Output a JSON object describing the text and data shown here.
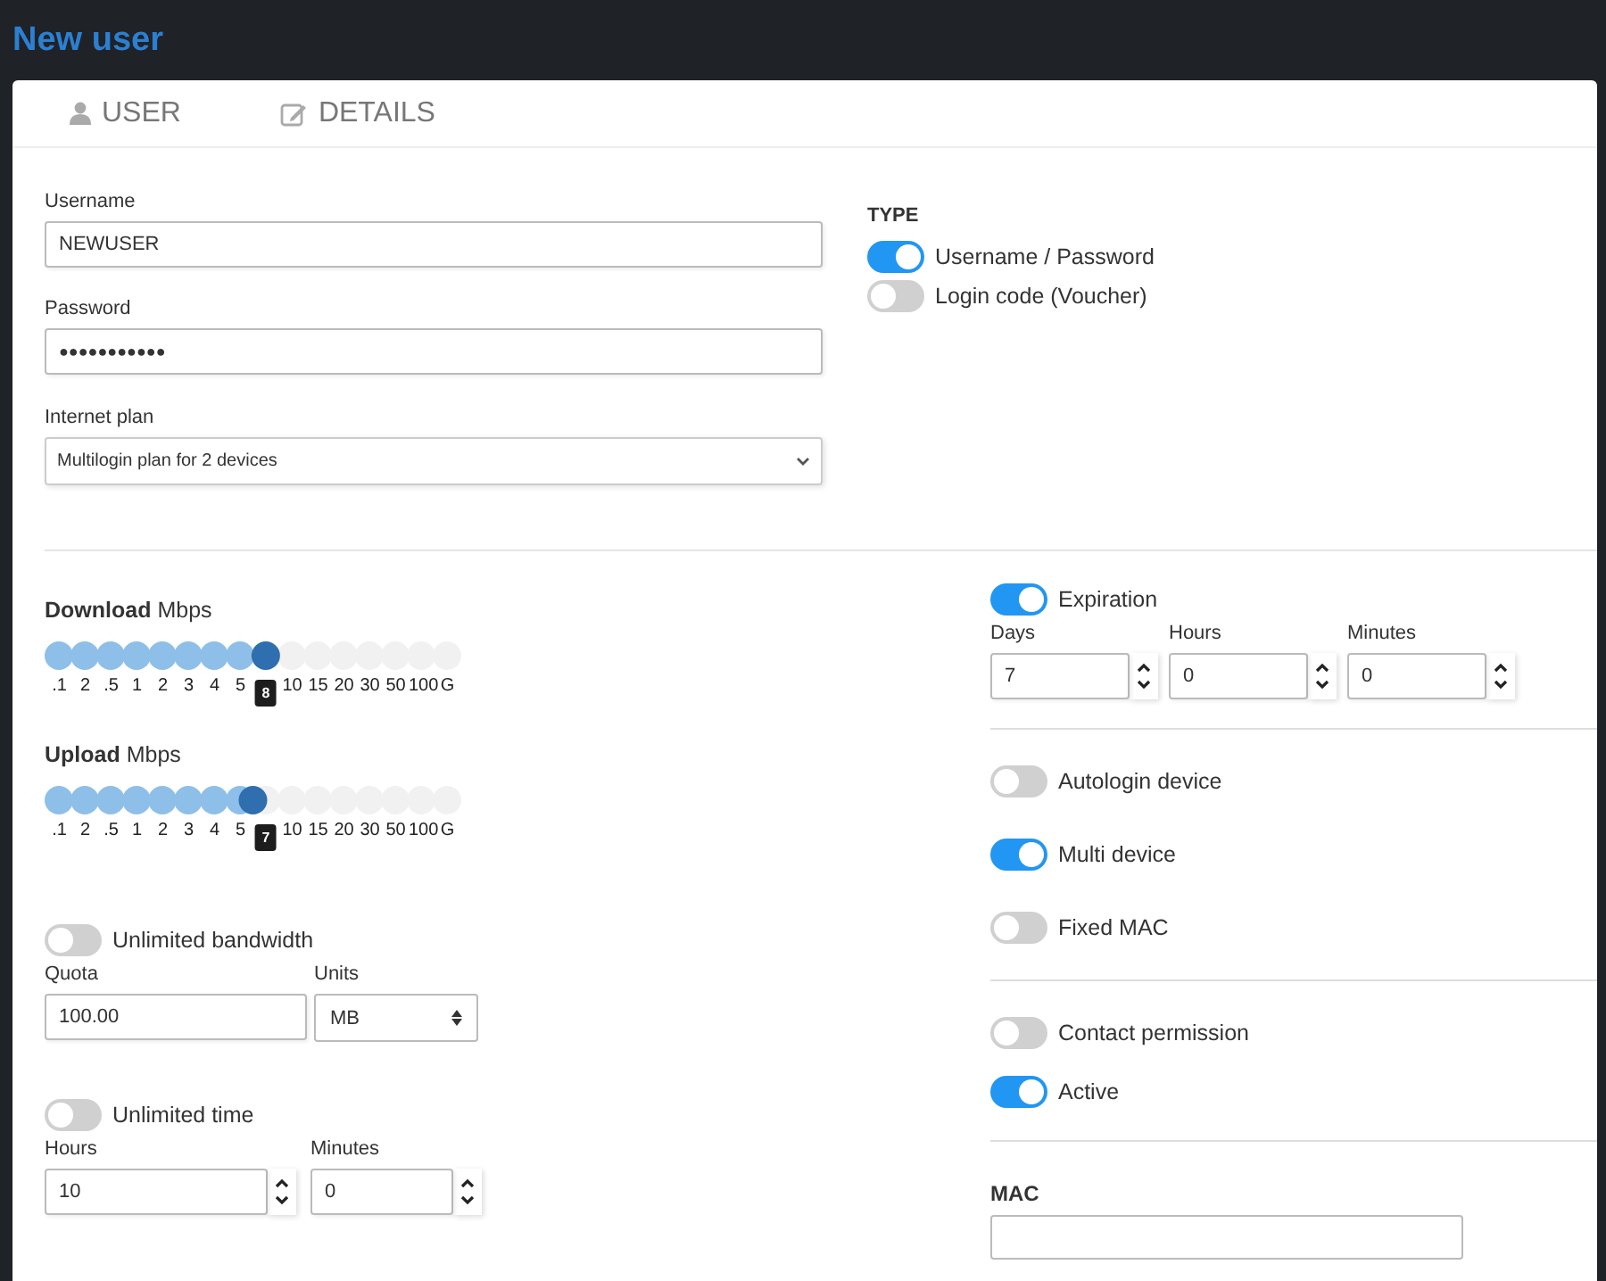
{
  "header": {
    "title": "New user"
  },
  "tabs": [
    {
      "label": "USER",
      "kind": "user"
    },
    {
      "label": "DETAILS",
      "kind": "edit"
    }
  ],
  "account": {
    "username": {
      "label": "Username",
      "value": "NEWUSER"
    },
    "password": {
      "label": "Password",
      "value": "●●●●●●●●●●●"
    },
    "plan": {
      "label": "Internet plan",
      "value": "Multilogin plan for 2 devices"
    }
  },
  "type": {
    "title": "TYPE",
    "options": [
      {
        "label": "Username / Password",
        "on": true
      },
      {
        "label": "Login code (Voucher)",
        "on": false
      }
    ]
  },
  "speeds": [
    {
      "title": "Download",
      "unit": "Mbps",
      "level": 0.533,
      "value_label": "8",
      "ticks": [
        ".1",
        "2",
        ".5",
        "1",
        "2",
        "3",
        "4",
        "5",
        "10",
        "15",
        "20",
        "30",
        "50",
        "100",
        "G"
      ]
    },
    {
      "title": "Upload",
      "unit": "Mbps",
      "level": 0.5,
      "value_label": "7",
      "ticks": [
        ".1",
        "2",
        ".5",
        "1",
        "2",
        "3",
        "4",
        "5",
        "10",
        "15",
        "20",
        "30",
        "50",
        "100",
        "G"
      ]
    }
  ],
  "bandwidth": {
    "toggle": {
      "label": "Unlimited bandwidth",
      "on": false
    },
    "quota": {
      "label": "Quota",
      "value": "100.00"
    },
    "units": {
      "label": "Units",
      "value": "MB"
    }
  },
  "time": {
    "toggle": {
      "label": "Unlimited time",
      "on": false
    },
    "fields": [
      {
        "label": "Hours",
        "value": "10"
      },
      {
        "label": "Minutes",
        "value": "0"
      }
    ]
  },
  "expiration": {
    "toggle": {
      "label": "Expiration",
      "on": true
    },
    "fields": [
      {
        "label": "Days",
        "value": "7"
      },
      {
        "label": "Hours",
        "value": "0"
      },
      {
        "label": "Minutes",
        "value": "0"
      }
    ]
  },
  "option_groups": [
    [
      {
        "label": "Autologin device",
        "on": false
      },
      {
        "label": "Multi device",
        "on": true
      },
      {
        "label": "Fixed MAC",
        "on": false
      }
    ],
    [
      {
        "label": "Contact permission",
        "on": false
      },
      {
        "label": "Active",
        "on": true
      }
    ]
  ],
  "mac": {
    "label": "MAC"
  }
}
